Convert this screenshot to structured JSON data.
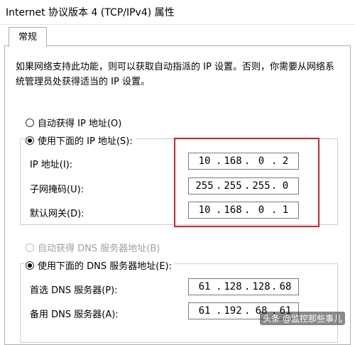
{
  "window": {
    "title": "Internet 协议版本 4 (TCP/IPv4) 属性"
  },
  "tabs": [
    {
      "label": "常规"
    }
  ],
  "description": "如果网络支持此功能，则可以获取自动指派的 IP 设置。否则，你需要从网络系统管理员处获得适当的 IP 设置。",
  "ip_section": {
    "auto_option": {
      "label": "自动获得 IP 地址(O)",
      "checked": false
    },
    "manual_option": {
      "label": "使用下面的 IP 地址(S):",
      "checked": true
    },
    "fields": [
      {
        "label": "IP 地址(I):",
        "octets": [
          "10",
          "168",
          "0",
          "2"
        ]
      },
      {
        "label": "子网掩码(U):",
        "octets": [
          "255",
          "255",
          "255",
          "0"
        ]
      },
      {
        "label": "默认网关(D):",
        "octets": [
          "10",
          "168",
          "0",
          "1"
        ]
      }
    ]
  },
  "dns_section": {
    "auto_option": {
      "label": "自动获得 DNS 服务器地址(B)",
      "checked": false,
      "disabled": true
    },
    "manual_option": {
      "label": "使用下面的 DNS 服务器地址(E):",
      "checked": true
    },
    "fields": [
      {
        "label": "首选 DNS 服务器(P):",
        "octets": [
          "61",
          "128",
          "128",
          "68"
        ]
      },
      {
        "label": "备用 DNS 服务器(A):",
        "octets": [
          "61",
          "192",
          "68",
          "61"
        ]
      }
    ]
  },
  "watermark": "头条 @监控那些事儿",
  "colors": {
    "highlight_border": "#b03434",
    "disabled_text": "#a0a0a0"
  }
}
